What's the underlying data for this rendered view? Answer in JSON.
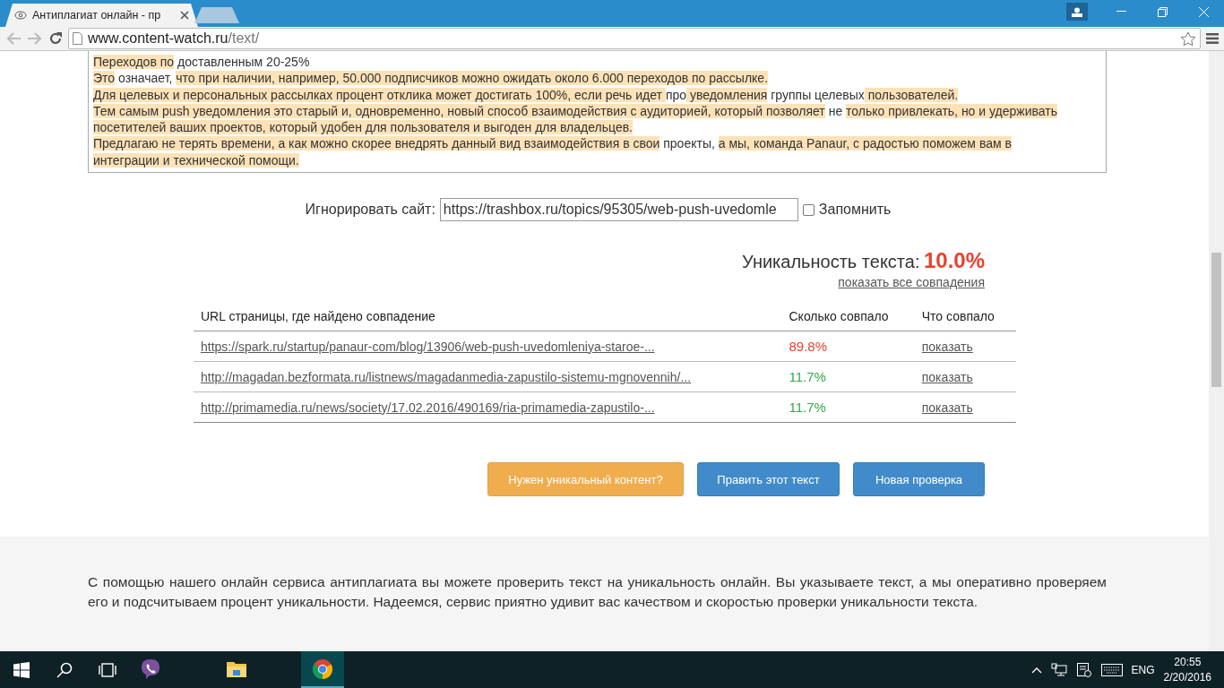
{
  "browser": {
    "tabs": [
      {
        "title": "Антиплагиат онлайн - пр",
        "selected": true
      },
      {
        "selected": false
      }
    ],
    "address": {
      "host": "www.content-watch.ru",
      "path": "/text/"
    }
  },
  "text_box": {
    "lines": [
      [
        {
          "text": "Переходов по",
          "highlighted": true
        },
        {
          "text": " доставленным 20-25%",
          "highlighted": false
        }
      ],
      [
        {
          "text": "Это",
          "highlighted": true
        },
        {
          "text": " означает, ",
          "highlighted": false
        },
        {
          "text": "что при наличии, например, 50.000 подписчиков можно ожидать около 6.000 переходов по рассылке.",
          "highlighted": true
        }
      ],
      [
        {
          "text": "Для целевых и персональных рассылках процент отклика может достигать 100%, если речь идет ",
          "highlighted": true
        },
        {
          "text": "про",
          "highlighted": false
        },
        {
          "text": " уведомления",
          "highlighted": true
        },
        {
          "text": " группы целевых",
          "highlighted": false
        },
        {
          "text": " пользователей. ",
          "highlighted": true
        }
      ],
      [
        {
          "text": "Тем самым push уведомления это старый и, одновременно, новый способ взаимодействия с аудиторией, который позволяет",
          "highlighted": true
        },
        {
          "text": " не ",
          "highlighted": false
        },
        {
          "text": "только привлекать, но и удерживать",
          "highlighted": true
        }
      ],
      [
        {
          "text": "посетителей ваших проектов, который удобен для пользователя и выгоден для владельцев. ",
          "highlighted": true
        }
      ],
      [
        {
          "text": "Предлагаю не терять времени, а как можно скорее внедрять данный вид взаимодействия в свои",
          "highlighted": true
        },
        {
          "text": " проекты, ",
          "highlighted": false
        },
        {
          "text": "а мы, команда Panaur, с радостью поможем вам в",
          "highlighted": true
        }
      ],
      [
        {
          "text": "интеграции и технической помощи.",
          "highlighted": true
        }
      ]
    ]
  },
  "ignore": {
    "label": "Игнорировать сайт:",
    "value": "https://trashbox.ru/topics/95305/web-push-uvedomle",
    "remember": {
      "label": "Запомнить",
      "checked": false
    }
  },
  "uniqueness": {
    "label": "Уникальность текста:",
    "value": "10.0%",
    "show_all_link": "показать все совпадения"
  },
  "table": {
    "columns": [
      "URL страницы, где найдено совпадение",
      "Сколько совпало",
      "Что совпало"
    ],
    "rows": [
      {
        "url": "https://spark.ru/startup/panaur-com/blog/13906/web-push-uvedomleniya-staroe-...",
        "match": "89.8%",
        "color": "#e8412c",
        "action": "показать"
      },
      {
        "url": "http://magadan.bezformata.ru/listnews/magadanmedia-zapustilo-sistemu-mgnovennih/...",
        "match": "11.7%",
        "color": "#35a94a",
        "action": "показать"
      },
      {
        "url": "http://primamedia.ru/news/society/17.02.2016/490169/ria-primamedia-zapustilo-...",
        "match": "11.7%",
        "color": "#35a94a",
        "action": "показать"
      }
    ]
  },
  "buttons": [
    {
      "label": "Нужен уникальный контент?",
      "kind": "orange"
    },
    {
      "label": "Править этот текст",
      "kind": "blue"
    },
    {
      "label": "Новая проверка",
      "kind": "blue"
    }
  ],
  "footer_text": "С помощью нашего онлайн сервиса антиплагиата вы можете проверить текст на уникальность онлайн. Вы указываете текст, а мы оперативно проверяем его и подсчитываем процент уникальности. Надеемся, сервис приятно удивит вас качеством и скоростью проверки уникальности текста.",
  "taskbar": {
    "apps": [
      {
        "kind": "viber",
        "active": false
      },
      {
        "kind": "explorer",
        "active": false
      },
      {
        "kind": "chrome",
        "active": true
      }
    ],
    "language": "ENG",
    "time": "20:55",
    "date": "2/20/2016"
  }
}
